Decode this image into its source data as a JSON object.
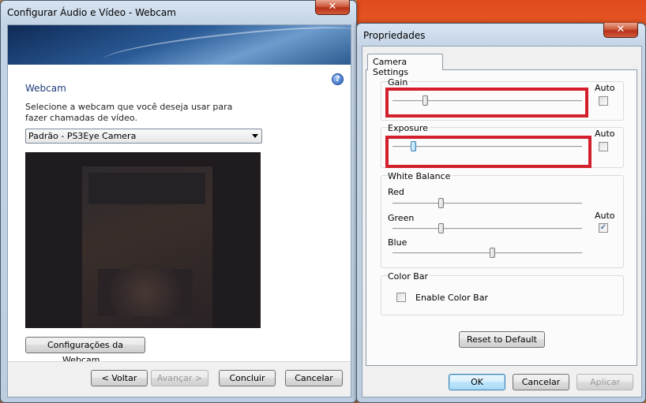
{
  "left_window": {
    "title": "Configurar Áudio e Vídeo - Webcam",
    "close_label": "✕",
    "heading": "Webcam",
    "help_icon": "?",
    "instruction": "Selecione a webcam que você deseja usar para fazer chamadas de vídeo.",
    "camera_select_value": "Padrão - PS3Eye Camera",
    "settings_button": "Configurações da Webcam...",
    "back_button": "< Voltar",
    "next_button": "Avançar >",
    "finish_button": "Concluir",
    "cancel_button": "Cancelar"
  },
  "right_window": {
    "title": "Propriedades",
    "close_label": "✕",
    "tab_label": "Camera Settings",
    "gain": {
      "label": "Gain",
      "auto_label": "Auto",
      "auto_checked": false,
      "level": 0.16
    },
    "exposure": {
      "label": "Exposure",
      "auto_label": "Auto",
      "auto_checked": false,
      "level": 0.1
    },
    "white_balance": {
      "label": "White Balance",
      "auto_label": "Auto",
      "auto_checked": true,
      "red": {
        "label": "Red",
        "level": 0.26
      },
      "green": {
        "label": "Green",
        "level": 0.26
      },
      "blue": {
        "label": "Blue",
        "level": 0.55
      }
    },
    "color_bar": {
      "label": "Color Bar",
      "checkbox_label": "Enable Color Bar",
      "checked": false
    },
    "reset_button": "Reset to Default",
    "ok_button": "OK",
    "cancel_button": "Cancelar",
    "apply_button": "Aplicar"
  }
}
